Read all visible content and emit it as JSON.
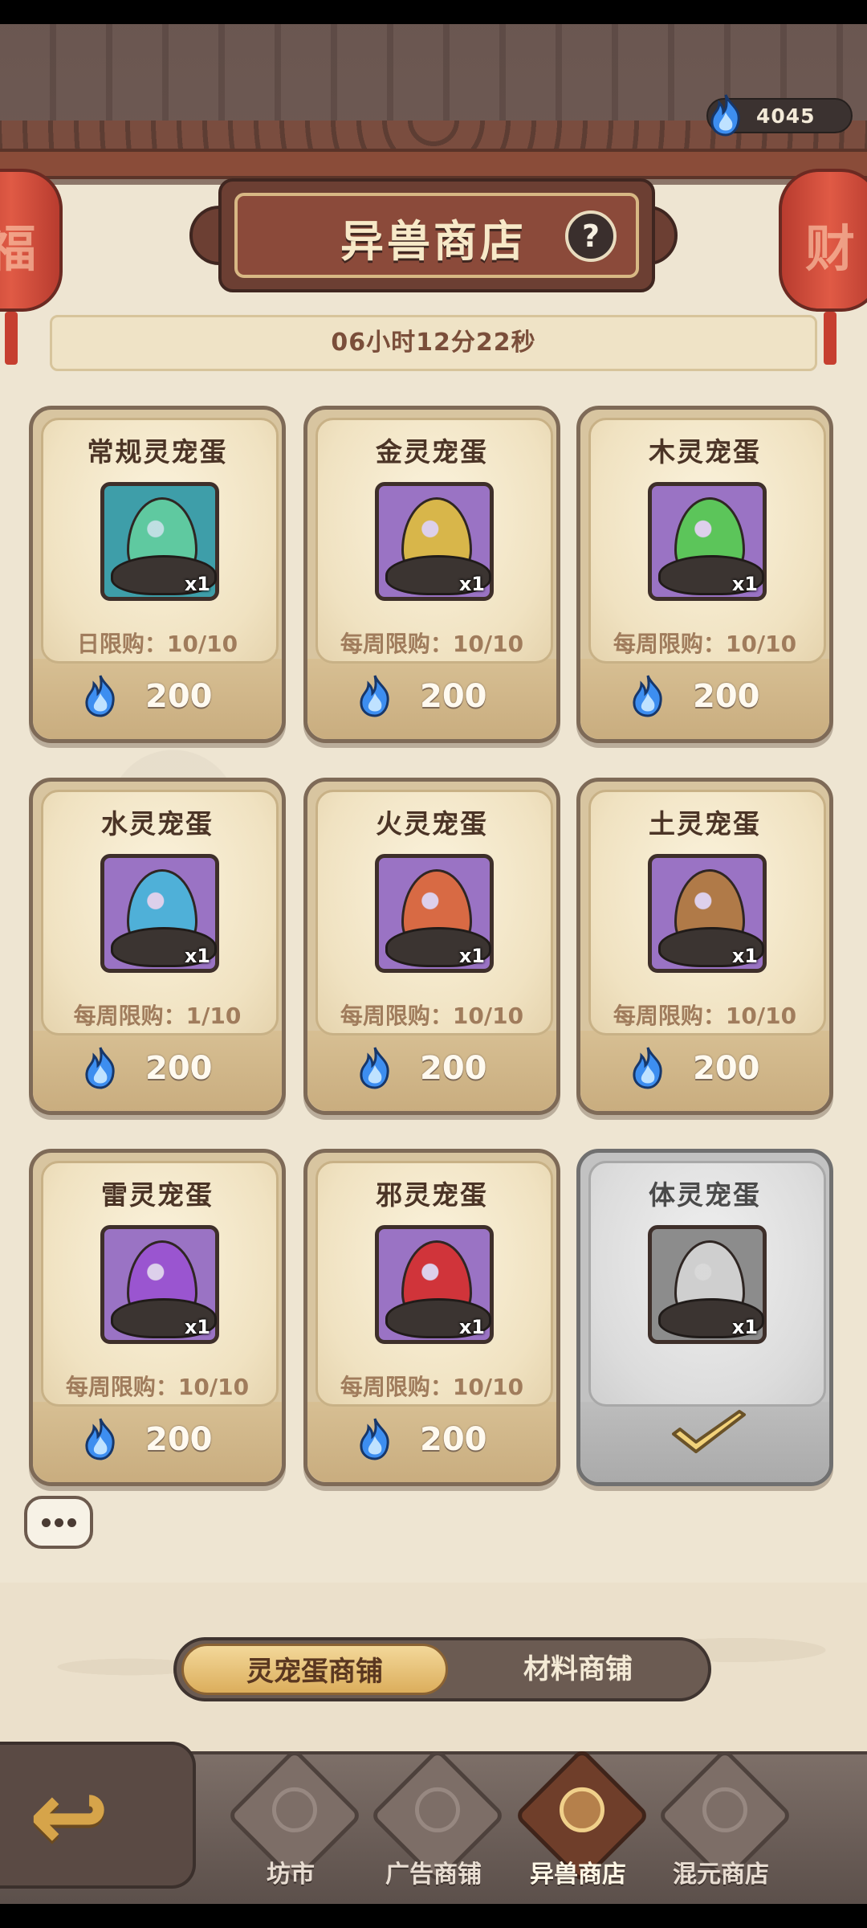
{
  "header": {
    "title": "异兽商店",
    "help_icon": "?",
    "currency_value": "4045",
    "currency_icon": "blue-flame-icon",
    "timer": "06小时12分22秒",
    "lantern_left_char": "福",
    "lantern_right_char": "财"
  },
  "cards": [
    {
      "name": "常规灵宠蛋",
      "qty": "x1",
      "limit": "日限购：10/10",
      "price": "200",
      "egg_color": "#5fc9a0",
      "bg": "teal"
    },
    {
      "name": "金灵宠蛋",
      "qty": "x1",
      "limit": "每周限购：10/10",
      "price": "200",
      "egg_color": "#d8b64a",
      "bg": "purple"
    },
    {
      "name": "木灵宠蛋",
      "qty": "x1",
      "limit": "每周限购：10/10",
      "price": "200",
      "egg_color": "#5cc55a",
      "bg": "purple"
    },
    {
      "name": "水灵宠蛋",
      "qty": "x1",
      "limit": "每周限购：1/10",
      "price": "200",
      "egg_color": "#4fb0d8",
      "bg": "purple"
    },
    {
      "name": "火灵宠蛋",
      "qty": "x1",
      "limit": "每周限购：10/10",
      "price": "200",
      "egg_color": "#d86a44",
      "bg": "purple"
    },
    {
      "name": "土灵宠蛋",
      "qty": "x1",
      "limit": "每周限购：10/10",
      "price": "200",
      "egg_color": "#b07a48",
      "bg": "purple"
    },
    {
      "name": "雷灵宠蛋",
      "qty": "x1",
      "limit": "每周限购：10/10",
      "price": "200",
      "egg_color": "#9a55d0",
      "bg": "purple"
    },
    {
      "name": "邪灵宠蛋",
      "qty": "x1",
      "limit": "每周限购：10/10",
      "price": "200",
      "egg_color": "#d0343a",
      "bg": "purple"
    },
    {
      "name": "体灵宠蛋",
      "qty": "x1",
      "limit": "",
      "price": "",
      "egg_color": "#cfcfcf",
      "bg": "gray",
      "sold_out": true
    }
  ],
  "tabs": {
    "active": "灵宠蛋商铺",
    "inactive": "材料商铺"
  },
  "nav": [
    {
      "label": "坊市",
      "active": false
    },
    {
      "label": "广告商铺",
      "active": false
    },
    {
      "label": "异兽商店",
      "active": true
    },
    {
      "label": "混元商店",
      "active": false
    }
  ],
  "colors": {
    "flame": "#4aa6ff",
    "accent": "#dcae5c"
  }
}
